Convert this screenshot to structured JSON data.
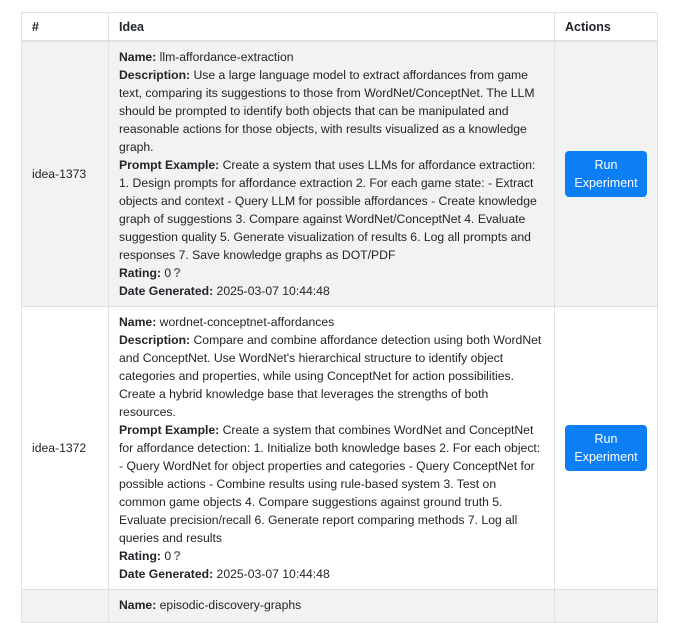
{
  "table": {
    "headers": {
      "id": "#",
      "idea": "Idea",
      "actions": "Actions"
    },
    "field_labels": {
      "name": "Name:",
      "description": "Description:",
      "prompt": "Prompt Example:",
      "rating": "Rating:",
      "date": "Date Generated:"
    },
    "run_button_label_1": "Run",
    "run_button_label_2": "Experiment",
    "rows": [
      {
        "id": "idea-1373",
        "name": "llm-affordance-extraction",
        "description": "Use a large language model to extract affordances from game text, comparing its suggestions to those from WordNet/ConceptNet. The LLM should be prompted to identify both objects that can be manipulated and reasonable actions for those objects, with results visualized as a knowledge graph.",
        "prompt": "Create a system that uses LLMs for affordance extraction: 1. Design prompts for affordance extraction 2. For each game state: - Extract objects and context - Query LLM for possible affordances - Create knowledge graph of suggestions 3. Compare against WordNet/ConceptNet 4. Evaluate suggestion quality 5. Generate visualization of results 6. Log all prompts and responses 7. Save knowledge graphs as DOT/PDF",
        "rating": "0",
        "date": "2025-03-07 10:44:48"
      },
      {
        "id": "idea-1372",
        "name": "wordnet-conceptnet-affordances",
        "description": "Compare and combine affordance detection using both WordNet and ConceptNet. Use WordNet's hierarchical structure to identify object categories and properties, while using ConceptNet for action possibilities. Create a hybrid knowledge base that leverages the strengths of both resources.",
        "prompt": "Create a system that combines WordNet and ConceptNet for affordance detection: 1. Initialize both knowledge bases 2. For each object: - Query WordNet for object properties and categories - Query ConceptNet for possible actions - Combine results using rule-based system 3. Test on common game objects 4. Compare suggestions against ground truth 5. Evaluate precision/recall 6. Generate report comparing methods 7. Log all queries and results",
        "rating": "0",
        "date": "2025-03-07 10:44:48"
      },
      {
        "name": "episodic-discovery-graphs"
      }
    ]
  }
}
